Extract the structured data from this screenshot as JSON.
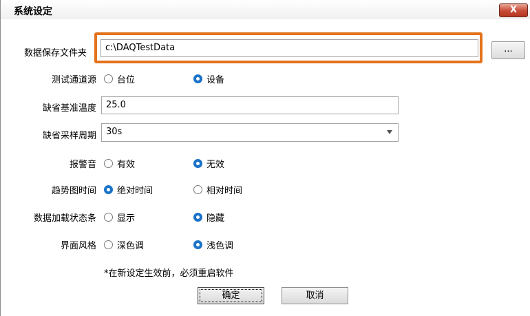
{
  "window": {
    "title": "系统设定",
    "close_label": "X"
  },
  "fields": {
    "data_folder": {
      "label": "数据保存文件夹",
      "value": "c:\\DAQTestData",
      "browse_label": "..."
    },
    "channel_source": {
      "label": "测试通道源",
      "options": [
        "台位",
        "设备"
      ],
      "selected": "设备"
    },
    "default_temp": {
      "label": "缺省基准温度",
      "value": "25.0"
    },
    "default_period": {
      "label": "缺省采样周期",
      "value": "30s"
    },
    "alarm": {
      "label": "报警音",
      "options": [
        "有效",
        "无效"
      ],
      "selected": "无效"
    },
    "trend_time": {
      "label": "趋势图时间",
      "options": [
        "绝对时间",
        "相对时间"
      ],
      "selected": "绝对时间"
    },
    "status_bar": {
      "label": "数据加载状态条",
      "options": [
        "显示",
        "隐藏"
      ],
      "selected": "隐藏"
    },
    "ui_style": {
      "label": "界面风格",
      "options": [
        "深色调",
        "浅色调"
      ],
      "selected": "浅色调"
    }
  },
  "note": "*在新设定生效前，必须重启软件",
  "buttons": {
    "ok": "确定",
    "cancel": "取消"
  },
  "colors": {
    "highlight": "#e3731c",
    "radio_selected": "#1a73c8",
    "close_button": "#c74a36"
  }
}
